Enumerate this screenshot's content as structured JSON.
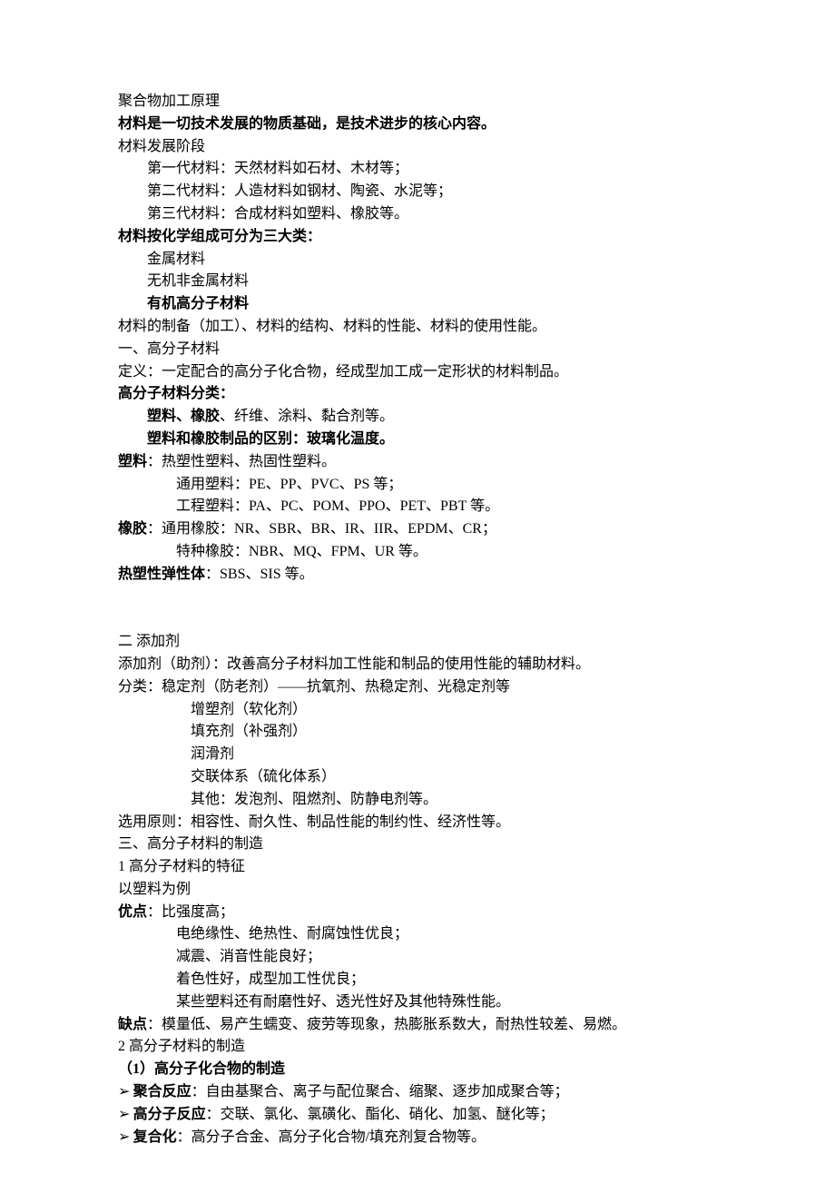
{
  "title": "聚合物加工原理",
  "heading1": "材料是一切技术发展的物质基础，是技术进步的核心内容。",
  "dev_stage_label": "材料发展阶段",
  "dev_stages": [
    "第一代材料：天然材料如石材、木材等；",
    "第二代材料：人造材料如钢材、陶瓷、水泥等；",
    "第三代材料：合成材料如塑料、橡胶等。"
  ],
  "category_heading": "材料按化学组成可分为三大类：",
  "categories": [
    "金属材料",
    "无机非金属材料",
    "有机高分子材料"
  ],
  "aspects": "材料的制备（加工）、材料的结构、材料的性能、材料的使用性能。",
  "sec1_title": "一、高分子材料",
  "sec1_def": "定义：一定配合的高分子化合物，经成型加工成一定形状的材料制品。",
  "classification_label": "高分子材料分类：",
  "classification_line1_bold": "塑料、橡胶",
  "classification_line1_rest": "、纤维、涂料、黏合剂等。",
  "classification_line2": "塑料和橡胶制品的区别：玻璃化温度。",
  "plastic_label": "塑料",
  "plastic_rest": "：热塑性塑料、热固性塑料。",
  "plastic_sub1": "通用塑料：PE、PP、PVC、PS 等；",
  "plastic_sub2": "工程塑料：PA、PC、POM、PPO、PET、PBT 等。",
  "rubber_label": "橡胶",
  "rubber_rest": "：通用橡胶：NR、SBR、BR、IR、IIR、EPDM、CR；",
  "rubber_sub1": "特种橡胶：NBR、MQ、FPM、UR 等。",
  "elastomer_label": "热塑性弹性体",
  "elastomer_rest": "：SBS、SIS 等。",
  "sec2_title": "二 添加剂",
  "sec2_def": "添加剂（助剂）：改善高分子材料加工性能和制品的使用性能的辅助材料。",
  "additive_class_label": "分类：稳定剂（防老剂）——抗氧剂、热稳定剂、光稳定剂等",
  "additive_items": [
    "增塑剂（软化剂）",
    "填充剂（补强剂）",
    "润滑剂",
    "交联体系（硫化体系）",
    "其他：发泡剂、阻燃剂、防静电剂等。"
  ],
  "selection_rule": "选用原则：相容性、耐久性、制品性能的制约性、经济性等。",
  "sec3_title": " 三、高分子材料的制造",
  "sec3_1": " 1  高分子材料的特征",
  "sec3_1_note": "  以塑料为例",
  "advantages_label": "优点",
  "advantages_first": "：比强度高；",
  "advantages_items": [
    "电绝缘性、绝热性、耐腐蚀性优良；",
    "减震、消音性能良好；",
    "着色性好，成型加工性优良；",
    "某些塑料还有耐磨性好、透光性好及其他特殊性能。"
  ],
  "disadvantages_label": "缺点",
  "disadvantages_rest": "：模量低、易产生蠕变、疲劳等现象，热膨胀系数大，耐热性较差、易燃。",
  "sec3_2": "2  高分子材料的制造",
  "sec3_2_1": "（1）高分子化合物的制造",
  "manufacture_items": [
    {
      "bold": "聚合反应",
      "rest": "：自由基聚合、离子与配位聚合、缩聚、逐步加成聚合等；"
    },
    {
      "bold": "高分子反应",
      "rest": "：交联、氯化、氯磺化、酯化、硝化、加氢、醚化等；"
    },
    {
      "bold": "复合化",
      "rest": "：高分子合金、高分子化合物/填充剂复合物等。"
    }
  ]
}
